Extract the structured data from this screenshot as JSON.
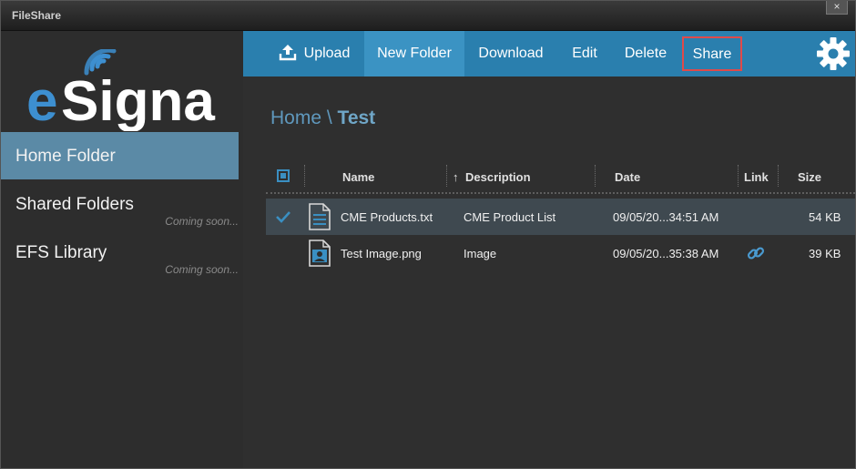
{
  "window": {
    "title": "FileShare",
    "close_label": "×"
  },
  "sidebar": {
    "logo_text": "eSignal",
    "items": [
      {
        "label": "Home Folder",
        "note": ""
      },
      {
        "label": "Shared Folders",
        "note": "Coming soon..."
      },
      {
        "label": "EFS Library",
        "note": "Coming soon..."
      }
    ]
  },
  "toolbar": {
    "upload": "Upload",
    "new_folder": "New Folder",
    "download": "Download",
    "edit": "Edit",
    "delete": "Delete",
    "share": "Share",
    "settings_icon": "gear-icon"
  },
  "breadcrumb": {
    "home": "Home",
    "separator": " \\ ",
    "current": "Test"
  },
  "table": {
    "columns": {
      "name": "Name",
      "description": "Description",
      "date": "Date",
      "link": "Link",
      "size": "Size"
    },
    "sort_indicator": "↑",
    "rows": [
      {
        "selected": true,
        "icon": "text-file-icon",
        "name": "CME Products.txt",
        "description": "CME Product List",
        "date": "09/05/20...34:51 AM",
        "link": "",
        "size": "54 KB"
      },
      {
        "selected": false,
        "icon": "image-file-icon",
        "name": "Test Image.png",
        "description": "Image",
        "date": "09/05/20...35:38 AM",
        "link": "link-icon",
        "size": "39 KB"
      }
    ]
  },
  "colors": {
    "accent": "#2a7fae",
    "active_nav": "#5b8aa6",
    "highlight_border": "#e04a4a"
  }
}
